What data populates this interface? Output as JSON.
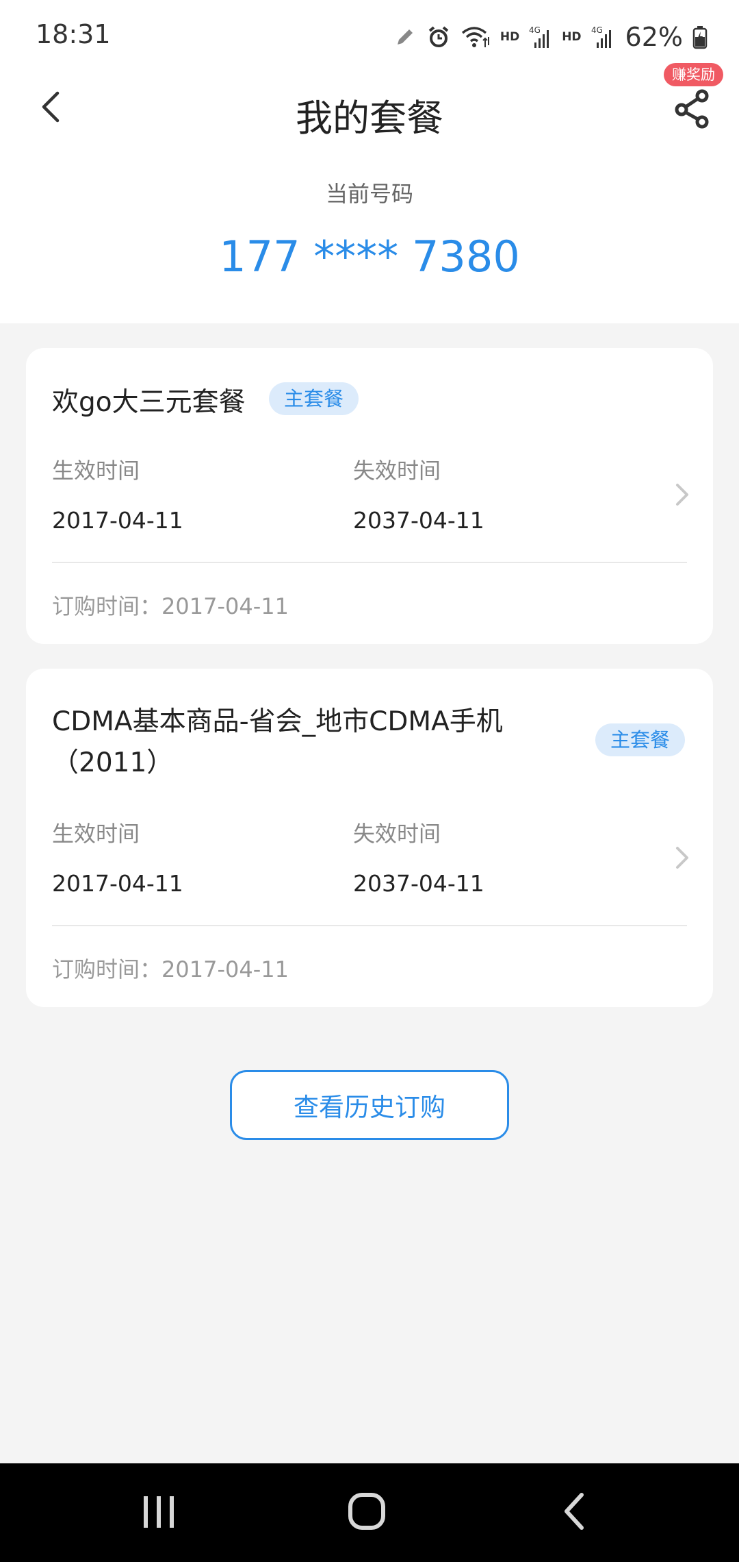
{
  "status_bar": {
    "time": "18:31",
    "hd_1": "HD",
    "hd_2": "HD",
    "battery": "62%"
  },
  "header": {
    "title": "我的套餐",
    "reward_badge": "赚奖励"
  },
  "current_number": {
    "label": "当前号码",
    "value": "177 **** 7380"
  },
  "plans": [
    {
      "name": "欢go大三元套餐",
      "badge": "主套餐",
      "effective_label": "生效时间",
      "effective_date": "2017-04-11",
      "expiry_label": "失效时间",
      "expiry_date": "2037-04-11",
      "order_text": "订购时间：2017-04-11"
    },
    {
      "name_line1": "CDMA基本商品-省会_地市CDMA手机",
      "name_line2": "（2011）",
      "badge": "主套餐",
      "effective_label": "生效时间",
      "effective_date": "2017-04-11",
      "expiry_label": "失效时间",
      "expiry_date": "2037-04-11",
      "order_text": "订购时间：2017-04-11"
    }
  ],
  "history_button": "查看历史订购",
  "colors": {
    "accent": "#2a8ce8",
    "badge_bg": "#dcebfb",
    "reward_bg": "#f05a63",
    "page_bg": "#f4f4f4"
  },
  "icons": [
    "pen-icon",
    "alarm-icon",
    "wifi-icon",
    "signal-4g-icon",
    "battery-icon",
    "back-arrow-icon",
    "share-icon",
    "chevron-right-icon",
    "recent-apps-icon",
    "home-icon",
    "nav-back-icon"
  ]
}
